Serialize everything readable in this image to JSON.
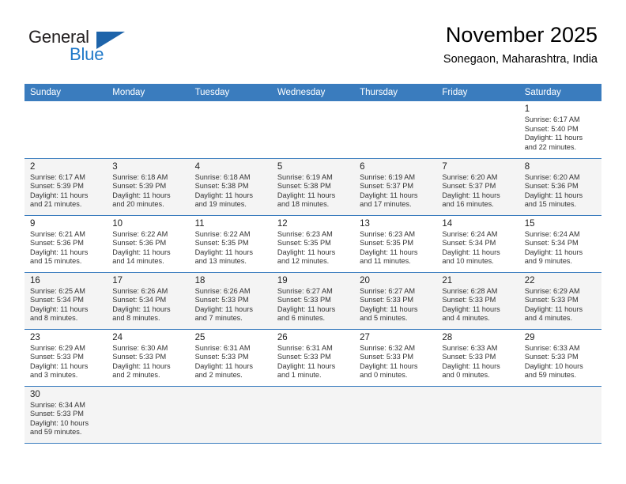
{
  "brand": {
    "name_top": "General",
    "name_bottom": "Blue",
    "accent_color": "#1f78c8",
    "triangle_color": "#1e64aa"
  },
  "header": {
    "title": "November 2025",
    "subtitle": "Sonegaon, Maharashtra, India"
  },
  "theme": {
    "header_row_color": "#3a7cbe",
    "alt_row_color": "#f4f4f4",
    "grid_line_color": "#3a7cbe"
  },
  "weekday_headers": [
    "Sunday",
    "Monday",
    "Tuesday",
    "Wednesday",
    "Thursday",
    "Friday",
    "Saturday"
  ],
  "weeks": [
    [
      {
        "day": "",
        "sunrise": "",
        "sunset": "",
        "daylight1": "",
        "daylight2": ""
      },
      {
        "day": "",
        "sunrise": "",
        "sunset": "",
        "daylight1": "",
        "daylight2": ""
      },
      {
        "day": "",
        "sunrise": "",
        "sunset": "",
        "daylight1": "",
        "daylight2": ""
      },
      {
        "day": "",
        "sunrise": "",
        "sunset": "",
        "daylight1": "",
        "daylight2": ""
      },
      {
        "day": "",
        "sunrise": "",
        "sunset": "",
        "daylight1": "",
        "daylight2": ""
      },
      {
        "day": "",
        "sunrise": "",
        "sunset": "",
        "daylight1": "",
        "daylight2": ""
      },
      {
        "day": "1",
        "sunrise": "Sunrise: 6:17 AM",
        "sunset": "Sunset: 5:40 PM",
        "daylight1": "Daylight: 11 hours",
        "daylight2": "and 22 minutes."
      }
    ],
    [
      {
        "day": "2",
        "sunrise": "Sunrise: 6:17 AM",
        "sunset": "Sunset: 5:39 PM",
        "daylight1": "Daylight: 11 hours",
        "daylight2": "and 21 minutes."
      },
      {
        "day": "3",
        "sunrise": "Sunrise: 6:18 AM",
        "sunset": "Sunset: 5:39 PM",
        "daylight1": "Daylight: 11 hours",
        "daylight2": "and 20 minutes."
      },
      {
        "day": "4",
        "sunrise": "Sunrise: 6:18 AM",
        "sunset": "Sunset: 5:38 PM",
        "daylight1": "Daylight: 11 hours",
        "daylight2": "and 19 minutes."
      },
      {
        "day": "5",
        "sunrise": "Sunrise: 6:19 AM",
        "sunset": "Sunset: 5:38 PM",
        "daylight1": "Daylight: 11 hours",
        "daylight2": "and 18 minutes."
      },
      {
        "day": "6",
        "sunrise": "Sunrise: 6:19 AM",
        "sunset": "Sunset: 5:37 PM",
        "daylight1": "Daylight: 11 hours",
        "daylight2": "and 17 minutes."
      },
      {
        "day": "7",
        "sunrise": "Sunrise: 6:20 AM",
        "sunset": "Sunset: 5:37 PM",
        "daylight1": "Daylight: 11 hours",
        "daylight2": "and 16 minutes."
      },
      {
        "day": "8",
        "sunrise": "Sunrise: 6:20 AM",
        "sunset": "Sunset: 5:36 PM",
        "daylight1": "Daylight: 11 hours",
        "daylight2": "and 15 minutes."
      }
    ],
    [
      {
        "day": "9",
        "sunrise": "Sunrise: 6:21 AM",
        "sunset": "Sunset: 5:36 PM",
        "daylight1": "Daylight: 11 hours",
        "daylight2": "and 15 minutes."
      },
      {
        "day": "10",
        "sunrise": "Sunrise: 6:22 AM",
        "sunset": "Sunset: 5:36 PM",
        "daylight1": "Daylight: 11 hours",
        "daylight2": "and 14 minutes."
      },
      {
        "day": "11",
        "sunrise": "Sunrise: 6:22 AM",
        "sunset": "Sunset: 5:35 PM",
        "daylight1": "Daylight: 11 hours",
        "daylight2": "and 13 minutes."
      },
      {
        "day": "12",
        "sunrise": "Sunrise: 6:23 AM",
        "sunset": "Sunset: 5:35 PM",
        "daylight1": "Daylight: 11 hours",
        "daylight2": "and 12 minutes."
      },
      {
        "day": "13",
        "sunrise": "Sunrise: 6:23 AM",
        "sunset": "Sunset: 5:35 PM",
        "daylight1": "Daylight: 11 hours",
        "daylight2": "and 11 minutes."
      },
      {
        "day": "14",
        "sunrise": "Sunrise: 6:24 AM",
        "sunset": "Sunset: 5:34 PM",
        "daylight1": "Daylight: 11 hours",
        "daylight2": "and 10 minutes."
      },
      {
        "day": "15",
        "sunrise": "Sunrise: 6:24 AM",
        "sunset": "Sunset: 5:34 PM",
        "daylight1": "Daylight: 11 hours",
        "daylight2": "and 9 minutes."
      }
    ],
    [
      {
        "day": "16",
        "sunrise": "Sunrise: 6:25 AM",
        "sunset": "Sunset: 5:34 PM",
        "daylight1": "Daylight: 11 hours",
        "daylight2": "and 8 minutes."
      },
      {
        "day": "17",
        "sunrise": "Sunrise: 6:26 AM",
        "sunset": "Sunset: 5:34 PM",
        "daylight1": "Daylight: 11 hours",
        "daylight2": "and 8 minutes."
      },
      {
        "day": "18",
        "sunrise": "Sunrise: 6:26 AM",
        "sunset": "Sunset: 5:33 PM",
        "daylight1": "Daylight: 11 hours",
        "daylight2": "and 7 minutes."
      },
      {
        "day": "19",
        "sunrise": "Sunrise: 6:27 AM",
        "sunset": "Sunset: 5:33 PM",
        "daylight1": "Daylight: 11 hours",
        "daylight2": "and 6 minutes."
      },
      {
        "day": "20",
        "sunrise": "Sunrise: 6:27 AM",
        "sunset": "Sunset: 5:33 PM",
        "daylight1": "Daylight: 11 hours",
        "daylight2": "and 5 minutes."
      },
      {
        "day": "21",
        "sunrise": "Sunrise: 6:28 AM",
        "sunset": "Sunset: 5:33 PM",
        "daylight1": "Daylight: 11 hours",
        "daylight2": "and 4 minutes."
      },
      {
        "day": "22",
        "sunrise": "Sunrise: 6:29 AM",
        "sunset": "Sunset: 5:33 PM",
        "daylight1": "Daylight: 11 hours",
        "daylight2": "and 4 minutes."
      }
    ],
    [
      {
        "day": "23",
        "sunrise": "Sunrise: 6:29 AM",
        "sunset": "Sunset: 5:33 PM",
        "daylight1": "Daylight: 11 hours",
        "daylight2": "and 3 minutes."
      },
      {
        "day": "24",
        "sunrise": "Sunrise: 6:30 AM",
        "sunset": "Sunset: 5:33 PM",
        "daylight1": "Daylight: 11 hours",
        "daylight2": "and 2 minutes."
      },
      {
        "day": "25",
        "sunrise": "Sunrise: 6:31 AM",
        "sunset": "Sunset: 5:33 PM",
        "daylight1": "Daylight: 11 hours",
        "daylight2": "and 2 minutes."
      },
      {
        "day": "26",
        "sunrise": "Sunrise: 6:31 AM",
        "sunset": "Sunset: 5:33 PM",
        "daylight1": "Daylight: 11 hours",
        "daylight2": "and 1 minute."
      },
      {
        "day": "27",
        "sunrise": "Sunrise: 6:32 AM",
        "sunset": "Sunset: 5:33 PM",
        "daylight1": "Daylight: 11 hours",
        "daylight2": "and 0 minutes."
      },
      {
        "day": "28",
        "sunrise": "Sunrise: 6:33 AM",
        "sunset": "Sunset: 5:33 PM",
        "daylight1": "Daylight: 11 hours",
        "daylight2": "and 0 minutes."
      },
      {
        "day": "29",
        "sunrise": "Sunrise: 6:33 AM",
        "sunset": "Sunset: 5:33 PM",
        "daylight1": "Daylight: 10 hours",
        "daylight2": "and 59 minutes."
      }
    ],
    [
      {
        "day": "30",
        "sunrise": "Sunrise: 6:34 AM",
        "sunset": "Sunset: 5:33 PM",
        "daylight1": "Daylight: 10 hours",
        "daylight2": "and 59 minutes."
      },
      {
        "day": "",
        "sunrise": "",
        "sunset": "",
        "daylight1": "",
        "daylight2": ""
      },
      {
        "day": "",
        "sunrise": "",
        "sunset": "",
        "daylight1": "",
        "daylight2": ""
      },
      {
        "day": "",
        "sunrise": "",
        "sunset": "",
        "daylight1": "",
        "daylight2": ""
      },
      {
        "day": "",
        "sunrise": "",
        "sunset": "",
        "daylight1": "",
        "daylight2": ""
      },
      {
        "day": "",
        "sunrise": "",
        "sunset": "",
        "daylight1": "",
        "daylight2": ""
      },
      {
        "day": "",
        "sunrise": "",
        "sunset": "",
        "daylight1": "",
        "daylight2": ""
      }
    ]
  ]
}
